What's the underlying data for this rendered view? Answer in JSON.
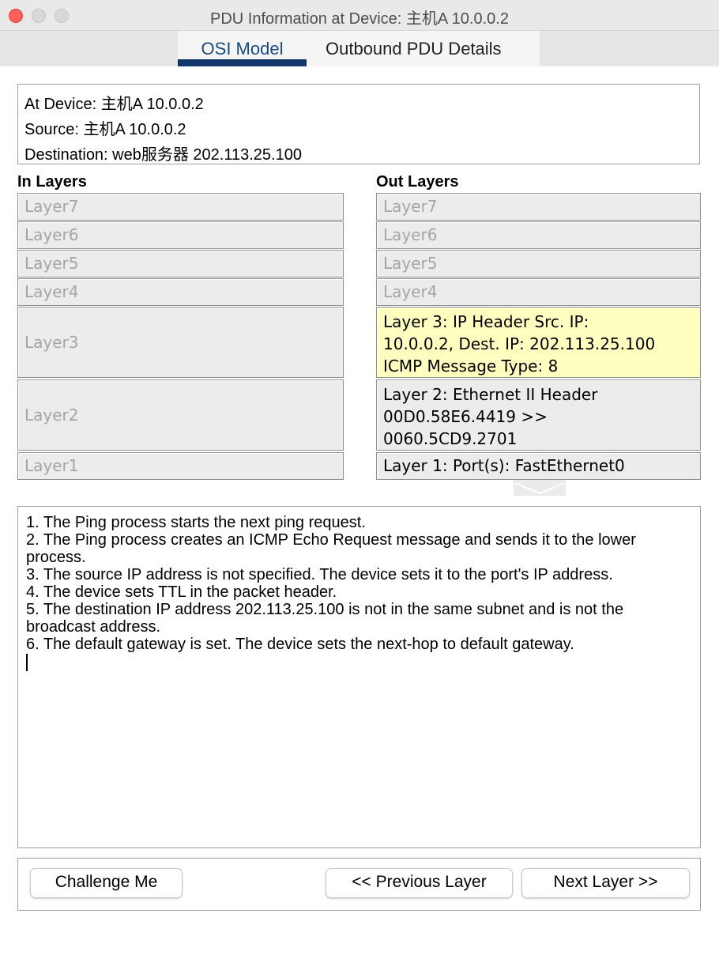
{
  "window": {
    "title": "PDU Information at Device: 主机A 10.0.0.2"
  },
  "tabs": [
    {
      "label": "OSI Model",
      "selected": true
    },
    {
      "label": "Outbound PDU Details",
      "selected": false
    }
  ],
  "info": {
    "at_device": "At Device: 主机A 10.0.0.2",
    "source": "Source: 主机A 10.0.0.2",
    "destination": "Destination: web服务器 202.113.25.100"
  },
  "in_layers": {
    "header": "In Layers",
    "items": [
      "Layer7",
      "Layer6",
      "Layer5",
      "Layer4",
      "Layer3",
      "Layer2",
      "Layer1"
    ]
  },
  "out_layers": {
    "header": "Out Layers",
    "items": [
      {
        "text": "Layer7"
      },
      {
        "text": "Layer6"
      },
      {
        "text": "Layer5"
      },
      {
        "text": "Layer4"
      },
      {
        "text": "Layer 3: IP Header Src. IP: 10.0.0.2, Dest. IP: 202.113.25.100 ICMP Message Type: 8",
        "lines": [
          "Layer 3: IP Header Src. IP:",
          "10.0.0.2, Dest. IP: 202.113.25.100",
          "ICMP Message Type: 8"
        ],
        "highlighted": true
      },
      {
        "text": "Layer 2: Ethernet II Header 00D0.58E6.4419 >> 0060.5CD9.2701",
        "lines": [
          "Layer 2: Ethernet II Header",
          "00D0.58E6.4419 >>",
          "0060.5CD9.2701"
        ]
      },
      {
        "text": "Layer 1: Port(s): FastEthernet0"
      }
    ]
  },
  "description": {
    "steps": [
      "1. The Ping process starts the next ping request.",
      "2. The Ping process creates an ICMP Echo Request message and sends it to the lower process.",
      "3. The source IP address is not specified. The device sets it to the port's IP address.",
      "4. The device sets TTL in the packet header.",
      "5. The destination IP address 202.113.25.100 is not in the same subnet and is not the broadcast address.",
      "6. The default gateway is set. The device sets the next-hop to default gateway."
    ]
  },
  "buttons": {
    "challenge": "Challenge Me",
    "previous": "<< Previous Layer",
    "next": "Next Layer >>"
  },
  "colors": {
    "highlight": "#ffffc0",
    "selected_tab": "#12376b",
    "close_button": "#fe5f57"
  }
}
